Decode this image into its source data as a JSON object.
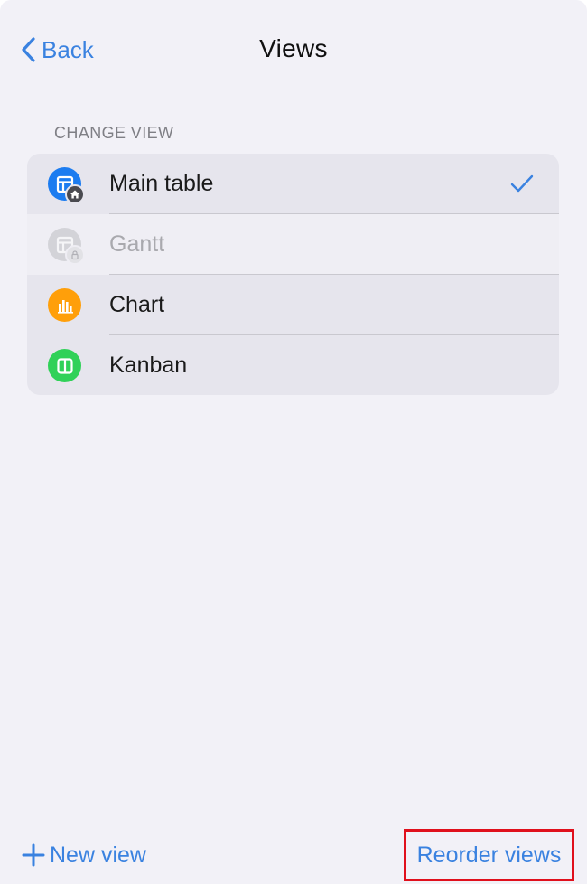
{
  "nav": {
    "back_label": "Back",
    "title": "Views"
  },
  "section": {
    "header": "CHANGE VIEW",
    "items": [
      {
        "label": "Main table",
        "icon": "table-icon",
        "badge": "home-icon",
        "icon_color": "#1c7cf0",
        "selected": true,
        "disabled": false
      },
      {
        "label": "Gantt",
        "icon": "table-icon",
        "badge": "lock-icon",
        "icon_color": "#d3d3d8",
        "selected": false,
        "disabled": true
      },
      {
        "label": "Chart",
        "icon": "bar-chart-icon",
        "icon_color": "#ff9f0a",
        "selected": false,
        "disabled": false
      },
      {
        "label": "Kanban",
        "icon": "kanban-icon",
        "icon_color": "#30d158",
        "selected": false,
        "disabled": false
      }
    ]
  },
  "toolbar": {
    "new_view_label": "New view",
    "reorder_label": "Reorder views"
  },
  "colors": {
    "accent": "#3a82e0",
    "highlight_border": "#e0101c",
    "background": "#f2f1f7"
  }
}
